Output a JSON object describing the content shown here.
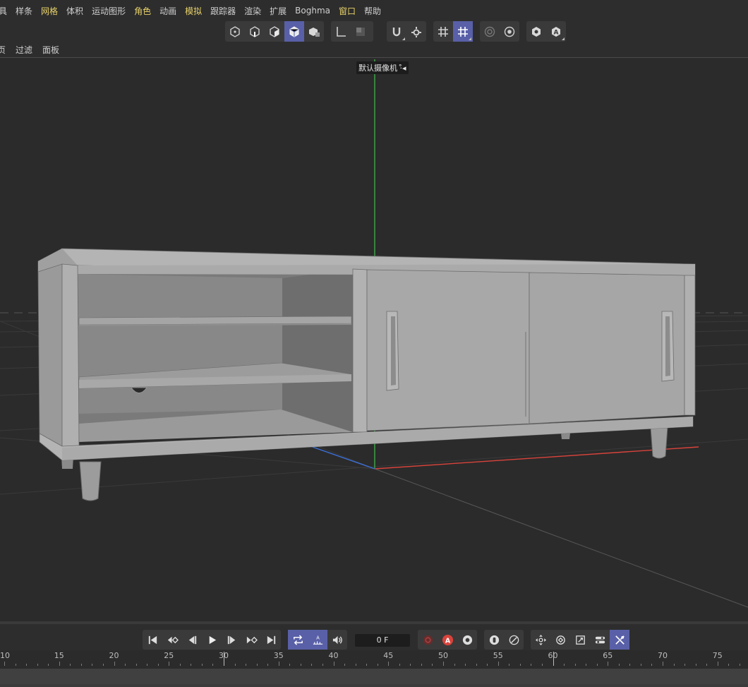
{
  "menu": [
    "具",
    "样条",
    "网格",
    "体积",
    "运动图形",
    "角色",
    "动画",
    "模拟",
    "跟踪器",
    "渲染",
    "扩展",
    "Boghma",
    "窗口",
    "帮助"
  ],
  "menu_highlight": [
    2,
    5,
    7,
    12
  ],
  "viewport_menu": [
    "页",
    "过滤",
    "面板"
  ],
  "camera_label": "默认摄像机 ·̊◂",
  "frame_field": "0 F",
  "ruler_labels": [
    "10",
    "15",
    "20",
    "25",
    "30",
    "35",
    "40",
    "45",
    "50",
    "55",
    "60",
    "65",
    "70",
    "75"
  ],
  "colors": {
    "accent": "#5960a8",
    "menu_highlight": "#e8d26a",
    "axis_y": "#3fbf4a",
    "axis_x": "#d9433b",
    "axis_z": "#3c6fd6"
  },
  "toolbar_icons": [
    "points-mode-icon",
    "edges-mode-icon",
    "polygons-mode-icon",
    "model-mode-icon",
    "object-mode-icon",
    "axis-icon",
    "texture-mode-icon",
    "snap-magnet-icon",
    "snap-settings-icon",
    "workplane-grid-icon",
    "grid-snap-icon",
    "render-view-icon",
    "render-settings-icon",
    "viewport-solo-icon",
    "auto-icon"
  ],
  "transport_icons": [
    "goto-start-icon",
    "prev-key-icon",
    "prev-frame-icon",
    "play-icon",
    "next-frame-icon",
    "next-key-icon",
    "goto-end-icon",
    "loop-icon",
    "autokey-tracks-icon",
    "sound-icon",
    "record-icon",
    "autokey-icon",
    "key-settings-icon",
    "key-lock-icon",
    "key-scale-icon",
    "move-key-icon",
    "rotate-key-icon",
    "scale-key-icon",
    "param-key-icon",
    "pla-key-icon"
  ]
}
